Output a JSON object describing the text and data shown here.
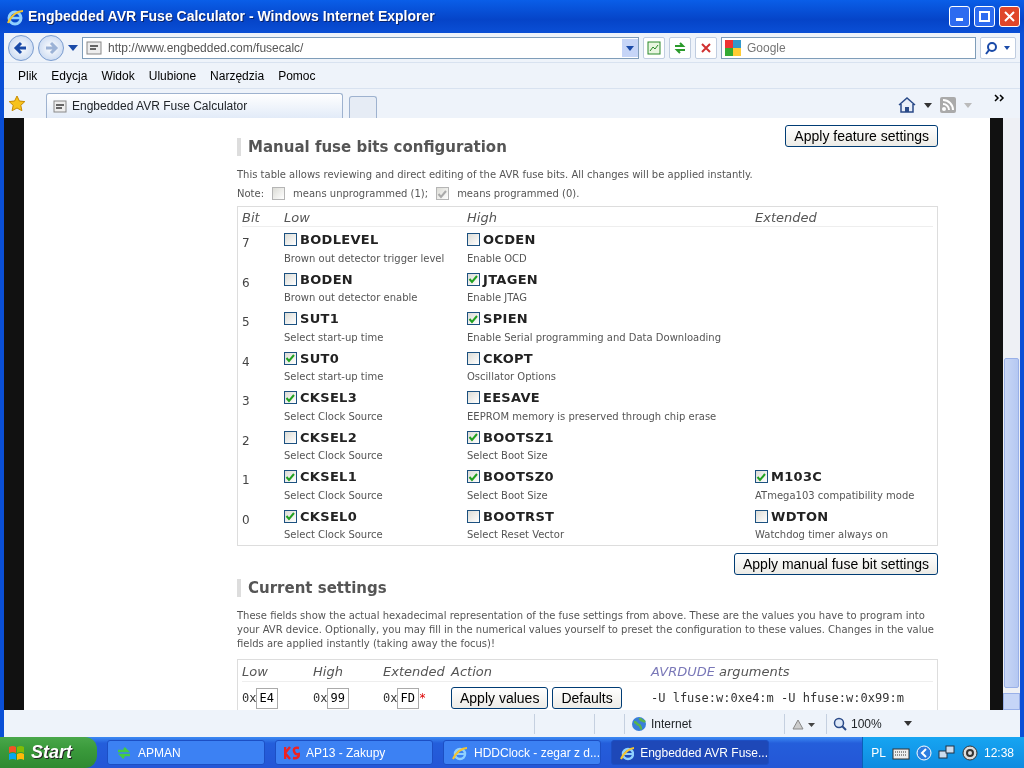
{
  "window": {
    "title": "Engbedded AVR Fuse Calculator - Windows Internet Explorer"
  },
  "address": {
    "value": "http://www.engbedded.com/fusecalc/"
  },
  "search": {
    "placeholder": "Google"
  },
  "menu": [
    "Plik",
    "Edycja",
    "Widok",
    "Ulubione",
    "Narzędzia",
    "Pomoc"
  ],
  "tabs": [
    {
      "label": "Engbedded AVR Fuse Calculator",
      "selected": true
    }
  ],
  "page": {
    "feature_button": "Apply feature settings",
    "manual_heading": "Manual fuse bits configuration",
    "manual_text": "This table allows reviewing and direct editing of the AVR fuse bits. All changes will be applied instantly.",
    "note": {
      "label": "Note:",
      "items": [
        {
          "checked": false,
          "text": "means unprogrammed (1);"
        },
        {
          "checked": true,
          "text": "means programmed (0)."
        }
      ]
    },
    "columns": [
      "Bit",
      "Low",
      "High",
      "Extended"
    ],
    "rows": [
      {
        "bit": "7",
        "low": {
          "name": "BODLEVEL",
          "desc": "Brown out detector trigger level",
          "checked": false
        },
        "high": {
          "name": "OCDEN",
          "desc": "Enable OCD",
          "checked": false
        }
      },
      {
        "bit": "6",
        "low": {
          "name": "BODEN",
          "desc": "Brown out detector enable",
          "checked": false
        },
        "high": {
          "name": "JTAGEN",
          "desc": "Enable JTAG",
          "checked": true
        }
      },
      {
        "bit": "5",
        "low": {
          "name": "SUT1",
          "desc": "Select start-up time",
          "checked": false
        },
        "high": {
          "name": "SPIEN",
          "desc": "Enable Serial programming and Data Downloading",
          "checked": true
        }
      },
      {
        "bit": "4",
        "low": {
          "name": "SUT0",
          "desc": "Select start-up time",
          "checked": true
        },
        "high": {
          "name": "CKOPT",
          "desc": "Oscillator Options",
          "checked": false
        }
      },
      {
        "bit": "3",
        "low": {
          "name": "CKSEL3",
          "desc": "Select Clock Source",
          "checked": true
        },
        "high": {
          "name": "EESAVE",
          "desc": "EEPROM memory is preserved through chip erase",
          "checked": false
        }
      },
      {
        "bit": "2",
        "low": {
          "name": "CKSEL2",
          "desc": "Select Clock Source",
          "checked": false
        },
        "high": {
          "name": "BOOTSZ1",
          "desc": "Select Boot Size",
          "checked": true
        }
      },
      {
        "bit": "1",
        "low": {
          "name": "CKSEL1",
          "desc": "Select Clock Source",
          "checked": true
        },
        "high": {
          "name": "BOOTSZ0",
          "desc": "Select Boot Size",
          "checked": true
        },
        "extended": {
          "name": "M103C",
          "desc": "ATmega103 compatibility mode",
          "checked": true
        }
      },
      {
        "bit": "0",
        "low": {
          "name": "CKSEL0",
          "desc": "Select Clock Source",
          "checked": true
        },
        "high": {
          "name": "BOOTRST",
          "desc": "Select Reset Vector",
          "checked": false
        },
        "extended": {
          "name": "WDTON",
          "desc": "Watchdog timer always on",
          "checked": false
        }
      }
    ],
    "manual_button": "Apply manual fuse bit settings",
    "current_heading": "Current settings",
    "current_text": "These fields show the actual hexadecimal representation of the fuse settings from above. These are the values you have to program into your AVR device. Optionally, you may fill in the numerical values yourself to preset the configuration to these values. Changes in the value fields are applied instantly (taking away the focus)!",
    "value_columns": [
      "Low",
      "High",
      "Extended",
      "Action"
    ],
    "avrdude_header": {
      "link": "AVRDUDE",
      "text": "arguments"
    },
    "values": [
      {
        "prefix": "0x",
        "value": "E4"
      },
      {
        "prefix": "0x",
        "value": "99"
      },
      {
        "prefix": "0x",
        "value": "FD",
        "required": "*"
      }
    ],
    "action_buttons": [
      "Apply values",
      "Defaults"
    ],
    "avrdude_args": "-U lfuse:w:0xe4:m -U hfuse:w:0x99:m"
  },
  "status_bar": {
    "zone": "Internet",
    "zoom": "100%"
  },
  "taskbar": {
    "start": "Start",
    "tasks": [
      {
        "label": "APMAN",
        "kind": "arrows",
        "selected": false
      },
      {
        "label": "AP13 - Zakupy",
        "kind": "ks",
        "selected": false
      },
      {
        "label": "HDDClock - zegar z d...",
        "kind": "ie",
        "selected": false
      },
      {
        "label": "Engbedded AVR Fuse...",
        "kind": "ie",
        "selected": true
      }
    ],
    "language": "PL",
    "clock": "12:38"
  }
}
